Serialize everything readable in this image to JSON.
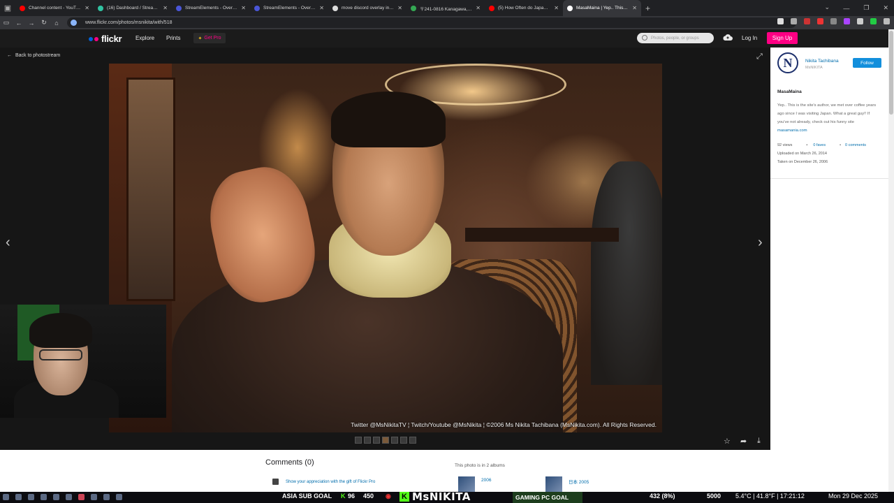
{
  "browser": {
    "tabs": [
      {
        "title": "Channel content - YouTube Stu",
        "color": "#ff0000",
        "active": false
      },
      {
        "title": "(16) Dashboard / Streamlabs",
        "color": "#31c3a2",
        "active": false
      },
      {
        "title": "StreamElements - Overlays",
        "color": "#4a56d8",
        "active": false
      },
      {
        "title": "StreamElements - Overlays",
        "color": "#4a56d8",
        "active": false
      },
      {
        "title": "move discord overlay in games",
        "color": "#dddddd",
        "active": false
      },
      {
        "title": "〒241-0816 Kanagawa, Yokoha",
        "color": "#34a853",
        "active": false
      },
      {
        "title": "(5) How Often do Japanese Pe",
        "color": "#ff0000",
        "active": false
      },
      {
        "title": "MasaMaina | Yep.. This is the si",
        "color": "#ffffff",
        "active": true
      }
    ],
    "url": "www.flickr.com/photos/msnikita/with/518"
  },
  "nav": {
    "logo": "flickr",
    "explore": "Explore",
    "prints": "Prints",
    "get_pro": "Get Pro",
    "search_placeholder": "Photos, people, or groups",
    "login": "Log In",
    "signup": "Sign Up"
  },
  "stage": {
    "back_label": "Back to photostream",
    "watermark": "Twitter @MsNikitaTV ¦ Twitch/Youtube @MsNikita ¦ ©2006 Ms Nikita Tachibana (MsNikita.com). All Rights Reserved."
  },
  "sidebar": {
    "owner_name": "Nikita Tachibana",
    "owner_handle": "MsNIKITA",
    "follow": "Follow",
    "photo_title": "MasaMaina",
    "desc_text": "Yep.. This is the site's author, we met over coffee years ago since I was visiting Japan. What a great guy!! If you've not already, check out his funny site",
    "desc_link": "masamania.com",
    "views": "92 views",
    "faves": "0 faves",
    "comments": "0 comments",
    "uploaded": "Uploaded on March 26, 2014",
    "taken": "Taken on December 26, 2006"
  },
  "lower": {
    "comments_title": "Comments (0)",
    "appreciation": "Show your appreciation with the gift of Flickr Pro",
    "albums_title": "This photo is in 2 albums",
    "albums": [
      {
        "name": "2006"
      },
      {
        "name": "日本 2005"
      }
    ]
  },
  "streambar": {
    "goal_label": "ASIA SUB GOAL",
    "goal_current": "96",
    "goal_target": "450",
    "channel": "MsNIKITA",
    "gaming_goal": "GAMING PC GOAL",
    "gaming_current": "432 (8%)",
    "gaming_target": "5000",
    "weather": "5.4°C | 41.8°F | 17:21:12",
    "date": "Mon 29 Dec 2025"
  },
  "colors": {
    "flickr_pink": "#ff0084",
    "flickr_blue": "#0063dc",
    "follow_blue": "#128fdc",
    "kick_green": "#53fc18"
  }
}
